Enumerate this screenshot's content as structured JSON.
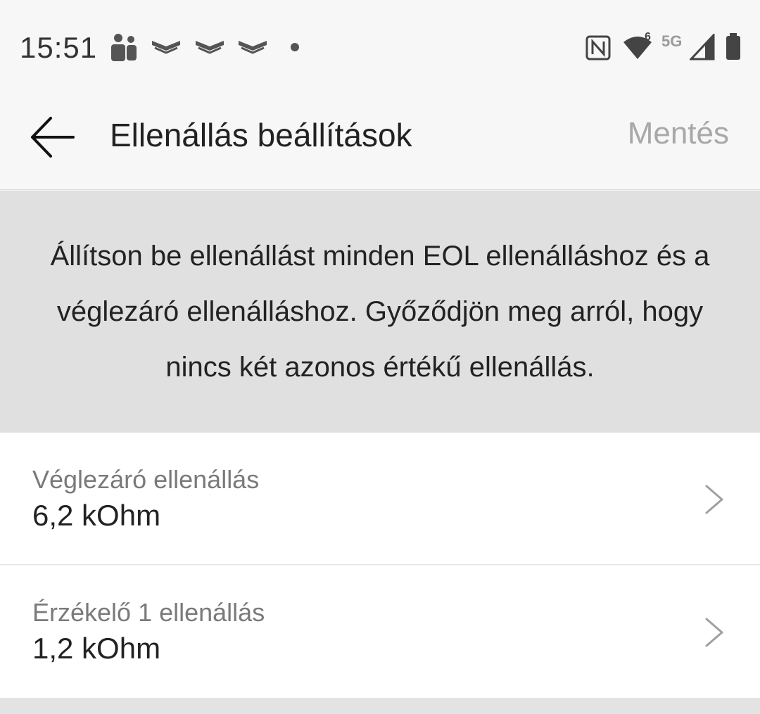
{
  "status_bar": {
    "time": "15:51",
    "network": "5G",
    "wifi_badge": "6",
    "icons": [
      "teams-icon",
      "chevron-stack-icon",
      "chevron-stack-icon",
      "chevron-stack-icon",
      "dot-icon",
      "nfc-icon",
      "wifi-icon",
      "signal-icon",
      "battery-icon"
    ]
  },
  "app_bar": {
    "title": "Ellenállás beállítások",
    "save_label": "Mentés"
  },
  "info": {
    "text": "Állítson be ellenállást minden EOL ellenálláshoz és a véglezáró ellenálláshoz. Győződjön meg arról, hogy nincs két azonos értékű ellenállás."
  },
  "items": [
    {
      "label": "Véglezáró ellenállás",
      "value": "6,2 kOhm"
    },
    {
      "label": "Érzékelő 1 ellenállás",
      "value": "1,2 kOhm"
    }
  ],
  "colors": {
    "background": "#f7f7f7",
    "banner": "#e0e0e0",
    "text": "#222222",
    "muted": "#7a7a7a",
    "disabled": "#a8a8a8"
  }
}
